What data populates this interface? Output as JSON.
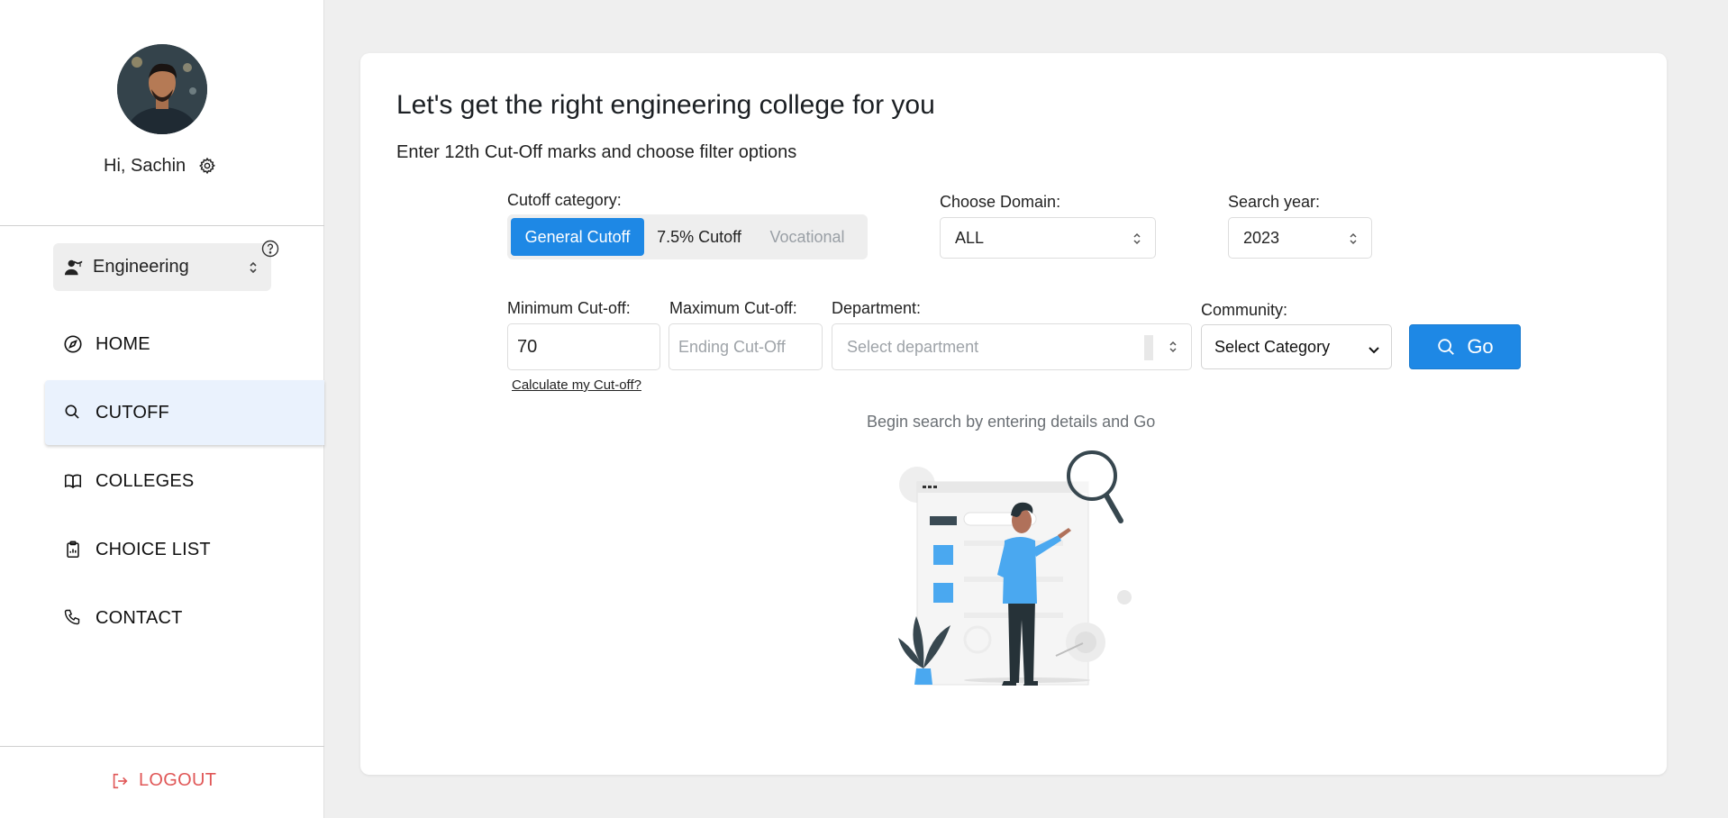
{
  "sidebar": {
    "greeting": "Hi, Sachin",
    "stream_selector": {
      "value": "Engineering"
    },
    "nav": [
      {
        "label": "HOME",
        "icon": "compass-icon"
      },
      {
        "label": "CUTOFF",
        "icon": "search-icon",
        "active": true
      },
      {
        "label": "COLLEGES",
        "icon": "book-icon"
      },
      {
        "label": "CHOICE LIST",
        "icon": "clipboard-icon"
      },
      {
        "label": "CONTACT",
        "icon": "phone-icon"
      }
    ],
    "logout_label": "LOGOUT"
  },
  "main": {
    "title": "Let's get the right engineering college for you",
    "subtitle": "Enter 12th Cut-Off marks and choose filter options",
    "cutoff_category": {
      "label": "Cutoff category:",
      "options": [
        "General Cutoff",
        "7.5% Cutoff",
        "Vocational"
      ],
      "selected": "General Cutoff"
    },
    "domain": {
      "label": "Choose Domain:",
      "value": "ALL"
    },
    "year": {
      "label": "Search year:",
      "value": "2023"
    },
    "min_cutoff": {
      "label": "Minimum Cut-off:",
      "value": "70"
    },
    "max_cutoff": {
      "label": "Maximum Cut-off:",
      "placeholder": "Ending Cut-Off"
    },
    "department": {
      "label": "Department:",
      "placeholder": "Select department"
    },
    "community": {
      "label": "Community:",
      "value": "Select Category"
    },
    "go_label": "Go",
    "calc_link": "Calculate my Cut-off?",
    "hint": "Begin search by entering details and Go"
  },
  "colors": {
    "accent": "#1e88e5",
    "active_nav_bg": "#eaf2fd",
    "logout": "#e05757",
    "page_bg": "#efefef"
  }
}
